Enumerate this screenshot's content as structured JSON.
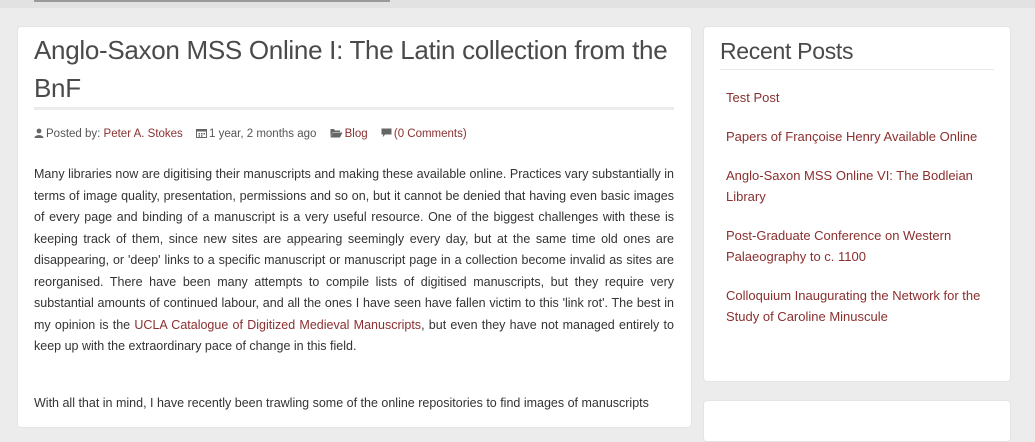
{
  "post": {
    "title": "Anglo-Saxon MSS Online I: The Latin collection from the BnF",
    "meta": {
      "posted_by_label": "Posted by:",
      "author": "Peter A. Stokes",
      "date": "1 year, 2 months ago",
      "category": "Blog",
      "comments": "(0 Comments)"
    },
    "para1_before_link": "Many libraries now are digitising their manuscripts and making these available online. Practices vary substantially in terms of image quality, presentation, permissions and so on, but it cannot be denied that having even basic images of every page and binding of a manuscript is a very useful resource. One of the biggest challenges with these is keeping track of them, since new sites are appearing seemingly every day, but at the same time old ones are disappearing, or 'deep' links to a specific manuscript or manuscript page in a collection become invalid as sites are reorganised. There have been many attempts to compile lists of digitised manuscripts, but they require very substantial amounts of continued labour, and all the ones I have seen have fallen victim to this 'link rot'. The best in my opinion is the ",
    "para1_link": "UCLA Catalogue of Digitized Medieval Manuscripts",
    "para1_after_link": ", but even they have not managed entirely to keep up with the extraordinary pace of change in this field.",
    "para2": "With all that in mind, I have recently been trawling some of the online repositories to find images of manuscripts"
  },
  "sidebar": {
    "title": "Recent Posts",
    "items": [
      {
        "label": "Test Post"
      },
      {
        "label": "Papers of Françoise Henry Available Online"
      },
      {
        "label": "Anglo-Saxon MSS Online VI: The Bodleian Library"
      },
      {
        "label": "Post-Graduate Conference on Western Palaeography to c. 1100"
      },
      {
        "label": "Colloquium Inaugurating the Network for the Study of Caroline Minuscule"
      }
    ]
  },
  "icons": {
    "author": "user-icon",
    "date": "calendar-icon",
    "category": "folder-open-icon",
    "comments": "comment-icon"
  },
  "colors": {
    "link": "#8b2f2f",
    "title": "#4a4a4a",
    "background": "#ececec"
  }
}
